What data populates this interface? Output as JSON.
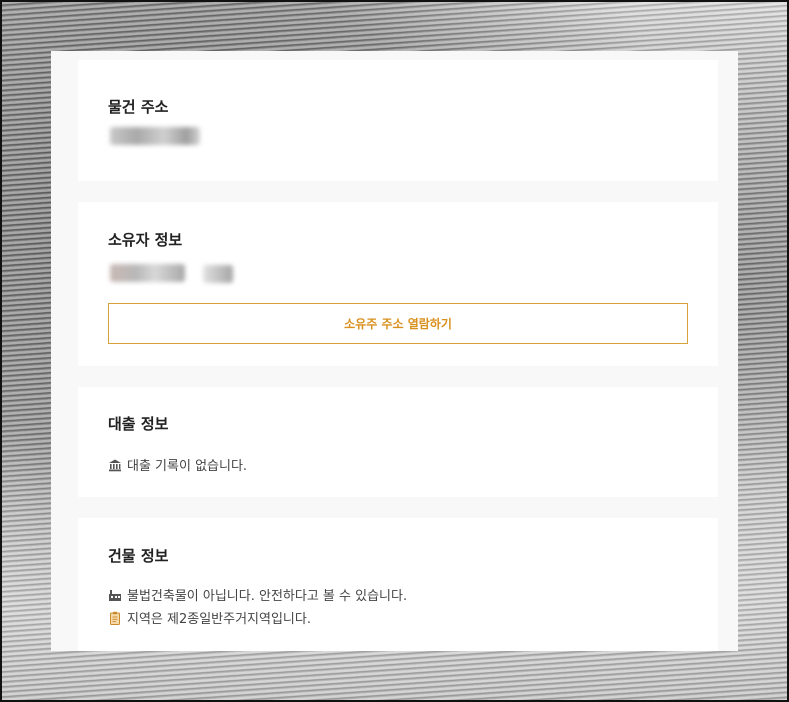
{
  "property_address": {
    "title": "물건 주소"
  },
  "owner_info": {
    "title": "소유자 정보",
    "reveal_button_label": "소유주 주소 열람하기"
  },
  "loan_info": {
    "title": "대출 정보",
    "icon": "bank-icon",
    "message": "대출 기록이 없습니다."
  },
  "building_info": {
    "title": "건물 정보",
    "items": [
      {
        "icon": "factory-icon",
        "text": "불법건축물이 아닙니다. 안전하다고 볼 수 있습니다."
      },
      {
        "icon": "clipboard-icon",
        "text": "지역은 제2종일반주거지역입니다."
      }
    ]
  },
  "colors": {
    "accent": "#d9a13b",
    "accent_text": "#d9901e",
    "card_bg": "#ffffff",
    "panel_bg": "#f8f8f8"
  }
}
